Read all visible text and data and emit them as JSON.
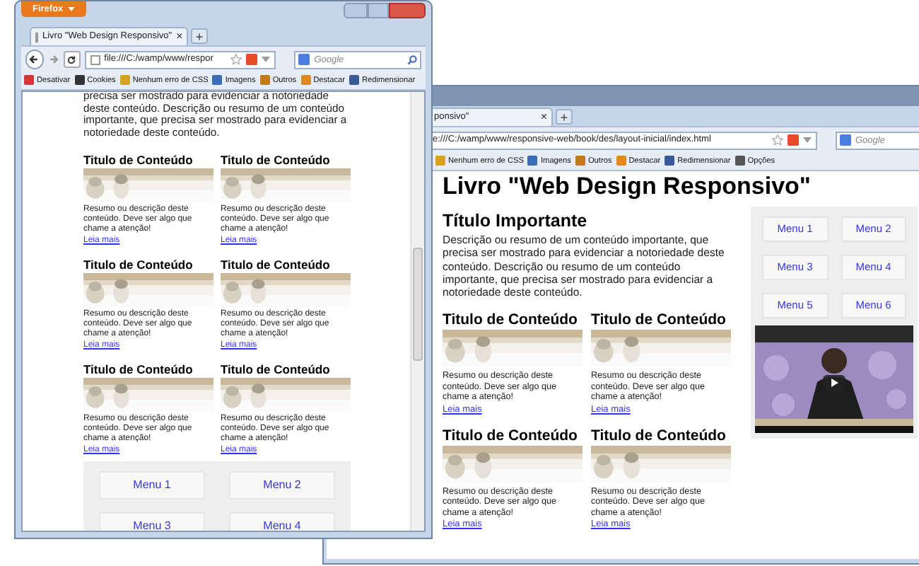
{
  "windows": [
    {
      "app_button": "Firefox",
      "tab": {
        "label": "Livro \"Web Design Responsivo\"",
        "close": "×"
      },
      "new_tab": "+",
      "url": "file:///C:/wamp/www/respor",
      "search": {
        "placeholder": "Google"
      },
      "bookmarks": [
        "Desativar",
        "Cookies",
        "Nenhum erro de CSS",
        "Imagens",
        "Outros",
        "Destacar",
        "Redimensionar"
      ],
      "page": {
        "intro": "precisa ser mostrado para evidenciar a notoriedade deste conteúdo. Descrição ou resumo de um conteúdo importante, que precisa ser mostrado para evidenciar a notoriedade deste conteúdo.",
        "cards": [
          {
            "title": "Titulo de Conteúdo",
            "description": "Resumo ou descrição deste conteúdo. Deve ser algo que chame a atenção!",
            "link": "Leia mais"
          },
          {
            "title": "Titulo de Conteúdo",
            "description": "Resumo ou descrição deste conteúdo. Deve ser algo que chame a atenção!",
            "link": "Leia mais"
          },
          {
            "title": "Titulo de Conteúdo",
            "description": "Resumo ou descrição deste conteúdo. Deve ser algo que chame a atenção!",
            "link": "Leia mais"
          },
          {
            "title": "Titulo de Conteúdo",
            "description": "Resumo ou descrição deste conteúdo. Deve ser algo que chame a atenção!",
            "link": "Leia mais"
          },
          {
            "title": "Titulo de Conteúdo",
            "description": "Resumo ou descrição deste conteúdo. Deve ser algo que chame a atenção!",
            "link": "Leia mais"
          },
          {
            "title": "Titulo de Conteúdo",
            "description": "Resumo ou descrição deste conteúdo. Deve ser algo que chame a atenção!",
            "link": "Leia mais"
          }
        ],
        "menu": [
          "Menu 1",
          "Menu 2",
          "Menu 3",
          "Menu 4"
        ]
      }
    },
    {
      "tab": {
        "label": "ponsivo\"",
        "close": "×"
      },
      "new_tab": "+",
      "url": "e:///C:/wamp/www/responsive-web/book/des/layout-inicial/index.html",
      "search": {
        "placeholder": "Google"
      },
      "bookmarks": [
        "Nenhum erro de CSS",
        "Imagens",
        "Outros",
        "Destacar",
        "Redimensionar",
        "Opções"
      ],
      "page": {
        "heading": "Livro \"Web Design Responsivo\"",
        "section_title": "Título Importante",
        "intro": "Descrição ou resumo de um conteúdo importante, que precisa ser mostrado para evidenciar a notoriedade deste conteúdo. Descrição ou resumo de um conteúdo importante, que precisa ser mostrado para evidenciar a notoriedade deste conteúdo.",
        "cards": [
          {
            "title": "Titulo de Conteúdo",
            "description": "Resumo ou descrição deste conteúdo. Deve ser algo que chame a atenção!",
            "link": "Leia mais"
          },
          {
            "title": "Titulo de Conteúdo",
            "description": "Resumo ou descrição deste conteúdo. Deve ser algo que chame a atenção!",
            "link": "Leia mais"
          },
          {
            "title": "Titulo de Conteúdo",
            "description": "Resumo ou descrição deste conteúdo. Deve ser algo que chame a atenção!",
            "link": "Leia mais"
          },
          {
            "title": "Titulo de Conteúdo",
            "description": "Resumo ou descrição deste conteúdo. Deve ser algo que chame a atenção!",
            "link": "Leia mais"
          }
        ],
        "menu": [
          "Menu 1",
          "Menu 2",
          "Menu 3",
          "Menu 4",
          "Menu 5",
          "Menu 6"
        ],
        "video": {
          "kind": "picture"
        }
      }
    }
  ]
}
